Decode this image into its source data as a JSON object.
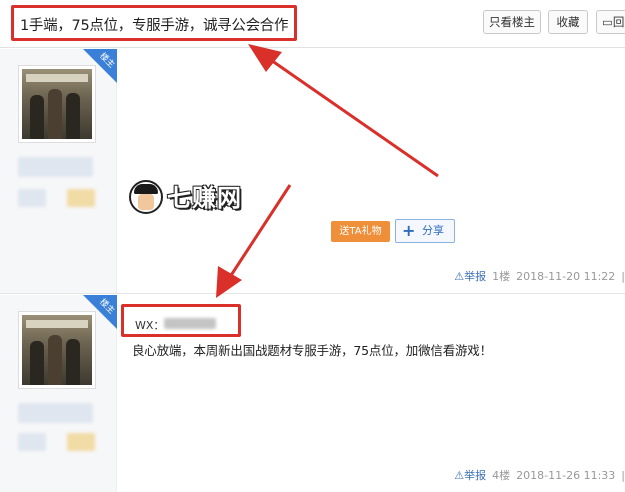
{
  "header": {
    "title": "1手端，75点位，专服手游，诚寻公会合作",
    "buttons": {
      "only_author": "只看楼主",
      "collect": "收藏",
      "reply": "回复"
    },
    "reply_icon": "comment-icon"
  },
  "posts": [
    {
      "author_badge": "楼主",
      "gift_button": "送TA礼物",
      "share_button": "分享",
      "share_icon": "plus-icon",
      "report": "举报",
      "report_icon": "warning-icon",
      "floor": "1楼",
      "time": "2018-11-20 11:22",
      "more": "|"
    },
    {
      "author_badge": "楼主",
      "wx_label": "WX：",
      "content": "良心放端，本周新出国战题材专服手游，75点位，加微信看游戏！",
      "report": "举报",
      "report_icon": "warning-icon",
      "floor": "4楼",
      "time": "2018-11-26 11:33",
      "more": "|"
    }
  ],
  "watermark": {
    "text": "七赚网",
    "icon": "detective-logo"
  },
  "colors": {
    "annotation_red": "#d9302a",
    "badge_blue": "#3a80d8",
    "gift_orange": "#f08f3a",
    "link_blue": "#3a6fb5"
  }
}
